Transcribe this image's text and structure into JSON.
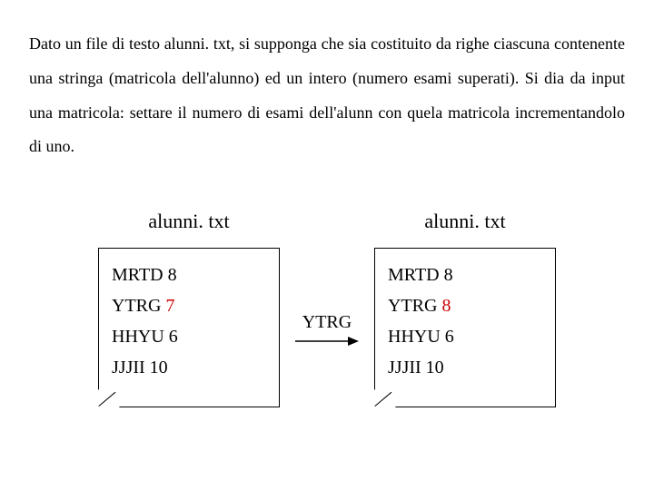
{
  "description": "Dato un file di testo alunni. txt, si supponga che sia costituito da righe ciascuna contenente una stringa (matricola dell'alunno) ed un intero (numero esami superati).  Si dia da input una matricola: settare il numero di esami dell'alunn con quela matricola incrementandolo di uno.",
  "file_left": {
    "title": "alunni. txt",
    "rows": [
      {
        "id": "MRTD",
        "val": "8",
        "highlight": false
      },
      {
        "id": "YTRG",
        "val": "7",
        "highlight": true
      },
      {
        "id": "HHYU",
        "val": "6",
        "highlight": false
      },
      {
        "id": "JJJII",
        "val": "10",
        "highlight": false
      }
    ]
  },
  "arrow_label": "YTRG",
  "file_right": {
    "title": "alunni. txt",
    "rows": [
      {
        "id": "MRTD",
        "val": "8",
        "highlight": false
      },
      {
        "id": "YTRG",
        "val": "8",
        "highlight": true
      },
      {
        "id": "HHYU",
        "val": "6",
        "highlight": false
      },
      {
        "id": "JJJII",
        "val": "10",
        "highlight": false
      }
    ]
  }
}
